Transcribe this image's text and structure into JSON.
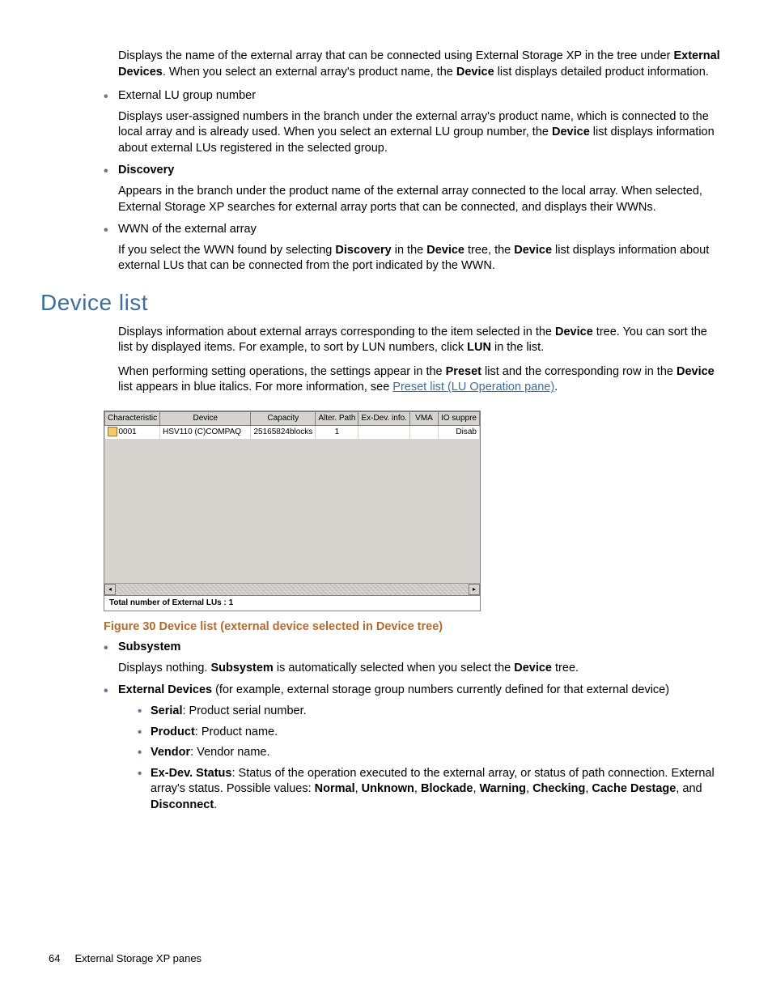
{
  "intro": {
    "p1a": "Displays the name of the external array that can be connected using External Storage XP in the tree under ",
    "p1b": "External Devices",
    "p1c": ".  When you select an external array's product name, the ",
    "p1d": "Device",
    "p1e": " list displays detailed product information."
  },
  "bullets_top": [
    {
      "title_plain": "External LU group number",
      "title_bold": false,
      "body": "Displays user-assigned numbers in the branch under the external array's product name, which is connected to the local array and is already used. When you select an external LU group number, the ",
      "body_bold1": "Device",
      "body_after1": " list displays information about external LUs registered in the selected group."
    },
    {
      "title_plain": "Discovery",
      "title_bold": true,
      "body": "Appears in the branch under the product name of the external array connected to the local array. When selected, External Storage XP searches for external array ports that can be connected, and displays their WWNs.",
      "body_bold1": "",
      "body_after1": ""
    },
    {
      "title_plain": "WWN of the external array",
      "title_bold": false,
      "body": "If you select the WWN found by selecting ",
      "body_bold1": "Discovery",
      "body_after1": " in the ",
      "body_bold2": "Device",
      "body_after2": " tree, the ",
      "body_bold3": "Device",
      "body_after3": " list displays information about external LUs that can be connected from the port indicated by the WWN."
    }
  ],
  "section_heading": "Device list",
  "section_body": {
    "p1a": "Displays information about external arrays corresponding to the item selected in the ",
    "p1b": "Device",
    "p1c": " tree.  You can sort the list by displayed items.  For example, to sort by LUN numbers, click ",
    "p1d": "LUN",
    "p1e": " in the list.",
    "p2a": "When performing setting operations, the settings appear in the ",
    "p2b": "Preset",
    "p2c": " list and the corresponding row in the ",
    "p2d": "Device",
    "p2e": " list appears in blue italics.  For more information, see ",
    "p2link": "Preset list (LU Operation pane)",
    "p2f": "."
  },
  "table": {
    "headers": [
      "Characteristic",
      "Device",
      "Capacity",
      "Alter. Path",
      "Ex-Dev. info.",
      "VMA",
      "IO suppre"
    ],
    "row": {
      "characteristic": "0001",
      "device": "HSV110 (C)COMPAQ",
      "capacity": "25165824blocks",
      "alter_path": "1",
      "exdev": "",
      "vma": "",
      "io": "Disab"
    },
    "footer": "Total number of External LUs : 1"
  },
  "figure_caption": "Figure 30 Device list (external device selected in Device tree)",
  "bullets_bottom": {
    "subsystem_label": "Subsystem",
    "subsystem_body_a": "Displays nothing. ",
    "subsystem_body_b": "Subsystem",
    "subsystem_body_c": " is automatically selected when you select the ",
    "subsystem_body_d": "Device",
    "subsystem_body_e": " tree.",
    "external_label": "External Devices",
    "external_after": " (for example, external storage group numbers currently defined for that external device)",
    "inner": [
      {
        "label": "Serial",
        "text": ":  Product serial number."
      },
      {
        "label": "Product",
        "text": ":  Product name."
      },
      {
        "label": "Vendor",
        "text": ":  Vendor name."
      }
    ],
    "exdev": {
      "label": "Ex-Dev. Status",
      "text1": ":  Status of the operation executed to the external array, or status of path connection.  External array's status.  Possible values: ",
      "vals": [
        "Normal",
        "Unknown",
        "Blockade",
        "Warning",
        "Checking",
        "Cache Destage",
        "Disconnect"
      ],
      "sep": ", ",
      "and": ", and ",
      "end": "."
    }
  },
  "footer": {
    "page": "64",
    "title": "External Storage XP panes"
  }
}
